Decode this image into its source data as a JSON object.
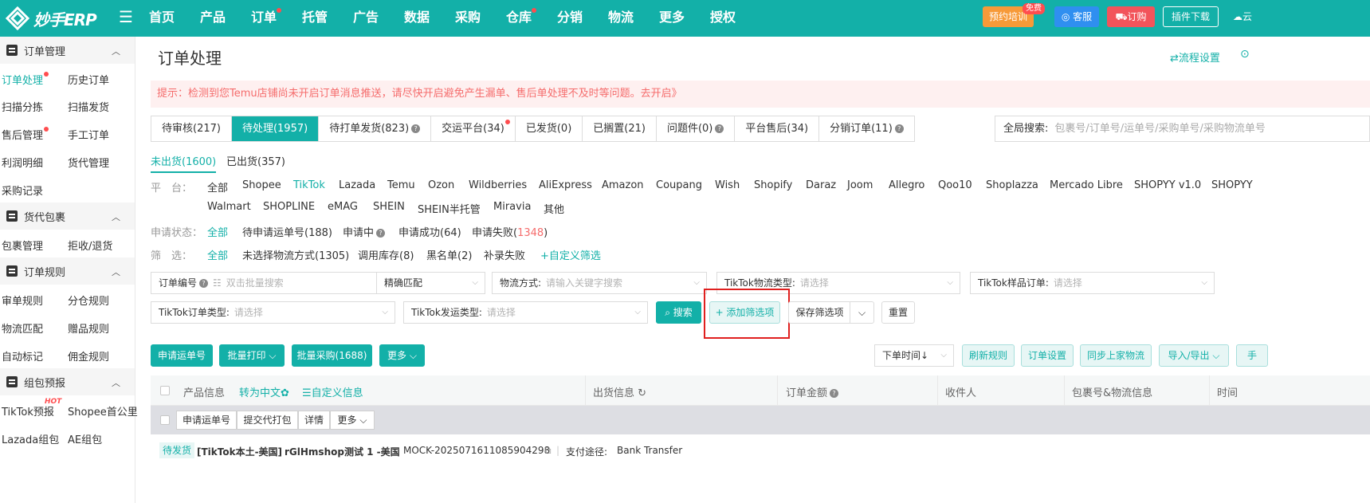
{
  "brand": {
    "logo_text": "妙手ERP"
  },
  "nav": [
    {
      "label": "首页"
    },
    {
      "label": "产品"
    },
    {
      "label": "订单"
    },
    {
      "label": "托管"
    },
    {
      "label": "广告"
    },
    {
      "label": "数据"
    },
    {
      "label": "采购"
    },
    {
      "label": "仓库"
    },
    {
      "label": "分销"
    },
    {
      "label": "物流"
    },
    {
      "label": "更多"
    },
    {
      "label": "授权"
    }
  ],
  "top_actions": {
    "train": "预约培训",
    "free_badge": "免费",
    "kefu": "客服",
    "order": "订购",
    "plugin": "插件下载",
    "cloud": "云"
  },
  "sidebar": {
    "groups": [
      {
        "title": "订单管理"
      },
      {
        "title": "货代包裹"
      },
      {
        "title": "订单规则"
      },
      {
        "title": "组包预报"
      }
    ],
    "items": [
      "订单处理",
      "历史订单",
      "扫描分拣",
      "扫描发货",
      "售后管理",
      "手工订单",
      "利润明细",
      "货代管理",
      "采购记录",
      "包裹管理",
      "拒收/退货",
      "审单规则",
      "分仓规则",
      "物流匹配",
      "赠品规则",
      "自动标记",
      "佣金规则",
      "TikTok预报",
      "Shopee首公里",
      "Lazada组包",
      "AE组包"
    ],
    "hot": "HOT"
  },
  "page": {
    "title": "订单处理",
    "flow_settings": "流程设置"
  },
  "alert": {
    "text": "提示：检测到您Temu店铺尚未开启订单消息推送，请尽快开启避免产生漏单、售后单处理不及时等问题。去开启》"
  },
  "tabs": [
    "待审核(217)",
    "待处理(1957)",
    "待打单发货(823)",
    "交运平台(34)",
    "已发货(0)",
    "已搁置(21)",
    "问题件(0)",
    "平台售后(34)",
    "分销订单(11)"
  ],
  "global_search": {
    "label": "全局搜索:",
    "placeholder": "包裹号/订单号/运单号/采购单号/采购物流单号"
  },
  "subtabs": [
    "未出货(1600)",
    "已出货(357)"
  ],
  "filters": {
    "platform_label": "平　台：",
    "platforms": [
      "全部",
      "Shopee",
      "TikTok",
      "Lazada",
      "Temu",
      "Ozon",
      "Wildberries",
      "AliExpress",
      "Amazon",
      "Coupang",
      "Wish",
      "Shopify",
      "Daraz",
      "Joom",
      "Allegro",
      "Qoo10",
      "Shoplazza",
      "Mercado Libre",
      "SHOPYY v1.0",
      "SHOPYY",
      "Walmart",
      "SHOPLINE",
      "eMAG",
      "SHEIN",
      "SHEIN半托管",
      "Miravia",
      "其他"
    ],
    "apply_label": "申请状态：",
    "apply": [
      "全部",
      "待申请运单号(188)",
      "申请中",
      "申请成功(64)",
      "申请失败("
    ],
    "apply_fail_count": "1348",
    "apply_close": ")",
    "screen_label": "筛　选：",
    "screen": [
      "全部",
      "未选择物流方式(1305)",
      "调用库存(8)",
      "黑名单(2)",
      "补录失败",
      "+自定义筛选"
    ]
  },
  "search_fields": {
    "order_no_label": "订单编号",
    "order_no_ph": "双击批量搜索",
    "match": "精确匹配",
    "logistics_label": "物流方式:",
    "logistics_ph": "请输入关键字搜索",
    "tt_logistics_type_label": "TikTok物流类型:",
    "tt_sample_label": "TikTok样品订单:",
    "tt_order_type_label": "TikTok订单类型:",
    "tt_ship_type_label": "TikTok发运类型:",
    "select_ph": "请选择",
    "search_btn": "搜索",
    "add_filter": "+ 添加筛选项",
    "save_filter": "保存筛选项",
    "reset": "重置"
  },
  "toolbar": {
    "apply_waybill": "申请运单号",
    "batch_print": "批量打印",
    "batch_purchase": "批量采购(1688)",
    "more": "更多",
    "sort": "下单时间↓",
    "refresh_rules": "刷新规则",
    "order_settings": "订单设置",
    "sync_logistics": "同步上家物流",
    "import_export": "导入/导出",
    "extra": "手"
  },
  "table": {
    "headers": [
      "产品信息",
      "转为中文",
      "自定义信息",
      "出货信息",
      "订单金额",
      "收件人",
      "包裹号&物流信息",
      "时间"
    ],
    "row_actions": [
      "申请运单号",
      "提交代打包",
      "详情",
      "更多"
    ],
    "row": {
      "status": "待发货",
      "store": "[TikTok本土-美国]",
      "shop": "rGlHmshop测试 1 -美国",
      "order_id": "MOCK-2025071611085904298",
      "pay_label": "支付途径:",
      "pay_method": "Bank Transfer"
    }
  }
}
